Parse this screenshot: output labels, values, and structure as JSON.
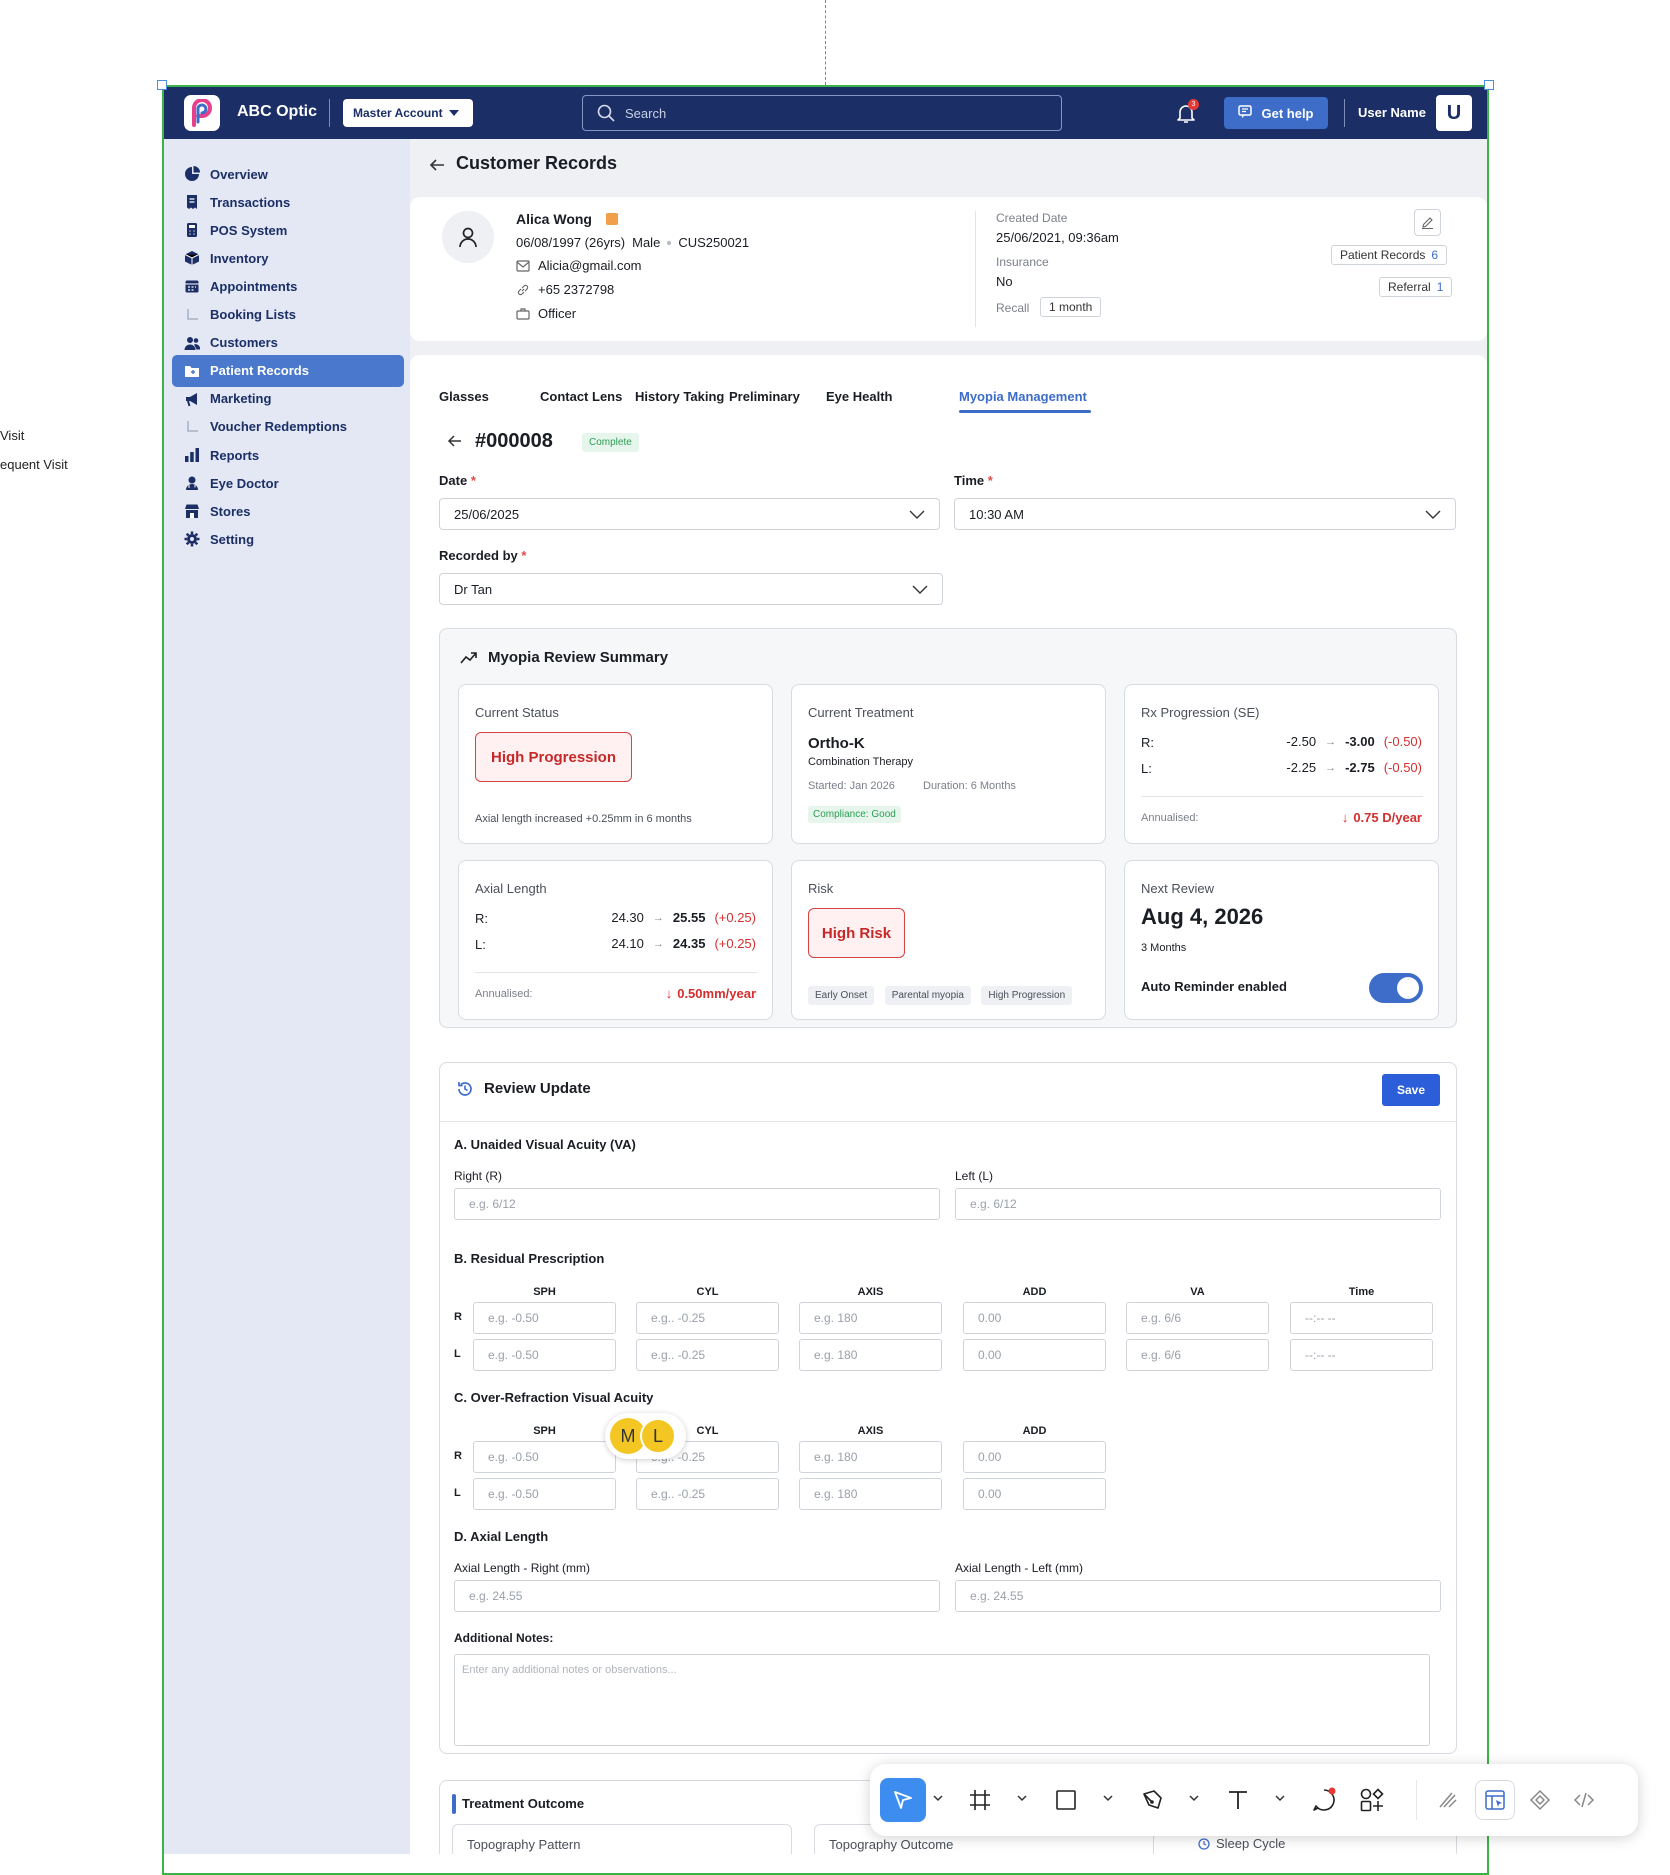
{
  "canvas": {
    "left_labels": [
      "Visit",
      "equent Visit"
    ]
  },
  "topbar": {
    "brand": "ABC Optic",
    "account_label": "Master Account",
    "search_placeholder": "Search",
    "notification_count": "3",
    "help_label": "Get help",
    "user_name": "User Name",
    "avatar_letter": "U"
  },
  "sidebar": {
    "items": [
      {
        "label": "Overview",
        "icon": "pie-chart-icon"
      },
      {
        "label": "Transactions",
        "icon": "receipt-icon"
      },
      {
        "label": "POS System",
        "icon": "calculator-icon"
      },
      {
        "label": "Inventory",
        "icon": "box-icon"
      },
      {
        "label": "Appointments",
        "icon": "calendar-icon"
      },
      {
        "label": "Booking Lists",
        "icon": "sub-branch-icon"
      },
      {
        "label": "Customers",
        "icon": "users-icon"
      },
      {
        "label": "Patient Records",
        "icon": "folder-icon"
      },
      {
        "label": "Marketing",
        "icon": "megaphone-icon"
      },
      {
        "label": "Voucher Redemptions",
        "icon": "sub-branch-icon"
      },
      {
        "label": "Reports",
        "icon": "bar-chart-icon"
      },
      {
        "label": "Eye Doctor",
        "icon": "doctor-icon"
      },
      {
        "label": "Stores",
        "icon": "store-icon"
      },
      {
        "label": "Setting",
        "icon": "gear-icon"
      }
    ],
    "active_index": 7
  },
  "page": {
    "title": "Customer Records"
  },
  "patient": {
    "name": "Alica Wong",
    "dob": "06/08/1997 (26yrs)",
    "gender": "Male",
    "customer_id": "CUS250021",
    "email": "Alicia@gmail.com",
    "phone": "+65 2372798",
    "occupation": "Officer",
    "created_label": "Created Date",
    "created_value": "25/06/2021, 09:36am",
    "insurance_label": "Insurance",
    "insurance_value": "No",
    "recall_label": "Recall",
    "recall_value": "1 month",
    "patient_records_label": "Patient Records",
    "patient_records_count": "6",
    "referral_label": "Referral",
    "referral_count": "1"
  },
  "tabs": [
    "Glasses",
    "Contact Lens",
    "History Taking",
    "Preliminary",
    "Eye Health",
    "Myopia Management"
  ],
  "active_tab": "Myopia Management",
  "record": {
    "id": "#000008",
    "status": "Complete",
    "date_label": "Date",
    "date_value": "25/06/2025",
    "time_label": "Time",
    "time_value": "10:30 AM",
    "recorded_by_label": "Recorded by",
    "recorded_by_value": "Dr Tan"
  },
  "summary": {
    "title": "Myopia Review Summary",
    "current_status": {
      "title": "Current Status",
      "badge": "High Progression",
      "note": "Axial length increased +0.25mm in 6 months"
    },
    "current_treatment": {
      "title": "Current Treatment",
      "name": "Ortho-K",
      "sub": "Combination Therapy",
      "started": "Started: Jan 2026",
      "duration": "Duration: 6 Months",
      "compliance": "Compliance: Good"
    },
    "rx_progression": {
      "title": "Rx Progression (SE)",
      "r_label": "R:",
      "r_from": "-2.50",
      "r_to": "-3.00",
      "r_delta": "(-0.50)",
      "l_label": "L:",
      "l_from": "-2.25",
      "l_to": "-2.75",
      "l_delta": "(-0.50)",
      "annual_label": "Annualised:",
      "annual_value": "0.75 D/year"
    },
    "axial_length": {
      "title": "Axial Length",
      "r_label": "R:",
      "r_from": "24.30",
      "r_to": "25.55",
      "r_delta": "(+0.25)",
      "l_label": "L:",
      "l_from": "24.10",
      "l_to": "24.35",
      "l_delta": "(+0.25)",
      "annual_label": "Annualised:",
      "annual_value": "0.50mm/year"
    },
    "risk": {
      "title": "Risk",
      "badge": "High Risk",
      "chips": [
        "Early Onset",
        "Parental myopia",
        "High Progression"
      ]
    },
    "next_review": {
      "title": "Next Review",
      "date": "Aug 4, 2026",
      "interval": "3 Months",
      "reminder_label": "Auto Reminder enabled",
      "reminder_on": true
    }
  },
  "review_update": {
    "title": "Review Update",
    "save_label": "Save",
    "va": {
      "title": "A. Unaided Visual Acuity (VA)",
      "right_label": "Right (R)",
      "right_placeholder": "e.g. 6/12",
      "left_label": "Left (L)",
      "left_placeholder": "e.g. 6/12"
    },
    "residual": {
      "title": "B. Residual Prescription",
      "columns": [
        "SPH",
        "CYL",
        "AXIS",
        "ADD",
        "VA",
        "Time"
      ],
      "rows": [
        {
          "label": "R",
          "values": [
            "e.g. -0.50",
            "e.g.. -0.25",
            "e.g. 180",
            "0.00",
            "e.g. 6/6",
            "--:-- --"
          ]
        },
        {
          "label": "L",
          "values": [
            "e.g. -0.50",
            "e.g.. -0.25",
            "e.g. 180",
            "0.00",
            "e.g. 6/6",
            "--:-- --"
          ]
        }
      ]
    },
    "over_refraction": {
      "title": "C. Over-Refraction Visual Acuity",
      "columns": [
        "SPH",
        "CYL",
        "AXIS",
        "ADD"
      ],
      "rows": [
        {
          "label": "R",
          "values": [
            "e.g. -0.50",
            "e.g.. -0.25",
            "e.g. 180",
            "0.00"
          ]
        },
        {
          "label": "L",
          "values": [
            "e.g. -0.50",
            "e.g.. -0.25",
            "e.g. 180",
            "0.00"
          ]
        }
      ]
    },
    "axial": {
      "title": "D. Axial Length",
      "right_label": "Axial Length - Right (mm)",
      "right_placeholder": "e.g. 24.55",
      "left_label": "Axial Length - Left (mm)",
      "left_placeholder": "e.g. 24.55"
    },
    "notes": {
      "label": "Additional Notes:",
      "placeholder": "Enter any additional notes or observations..."
    }
  },
  "treatment_outcome": {
    "title": "Treatment Outcome",
    "col1": "Topography Pattern",
    "col2": "Topography Outcome",
    "col3": "Sleep Cycle"
  },
  "cursors": {
    "first": "M",
    "second": "L"
  },
  "colors": {
    "navy": "#1b2f66",
    "accent": "#3d6cc9",
    "danger": "#d32f2f",
    "success": "#2e9d54",
    "selection": "#3cb34a"
  }
}
